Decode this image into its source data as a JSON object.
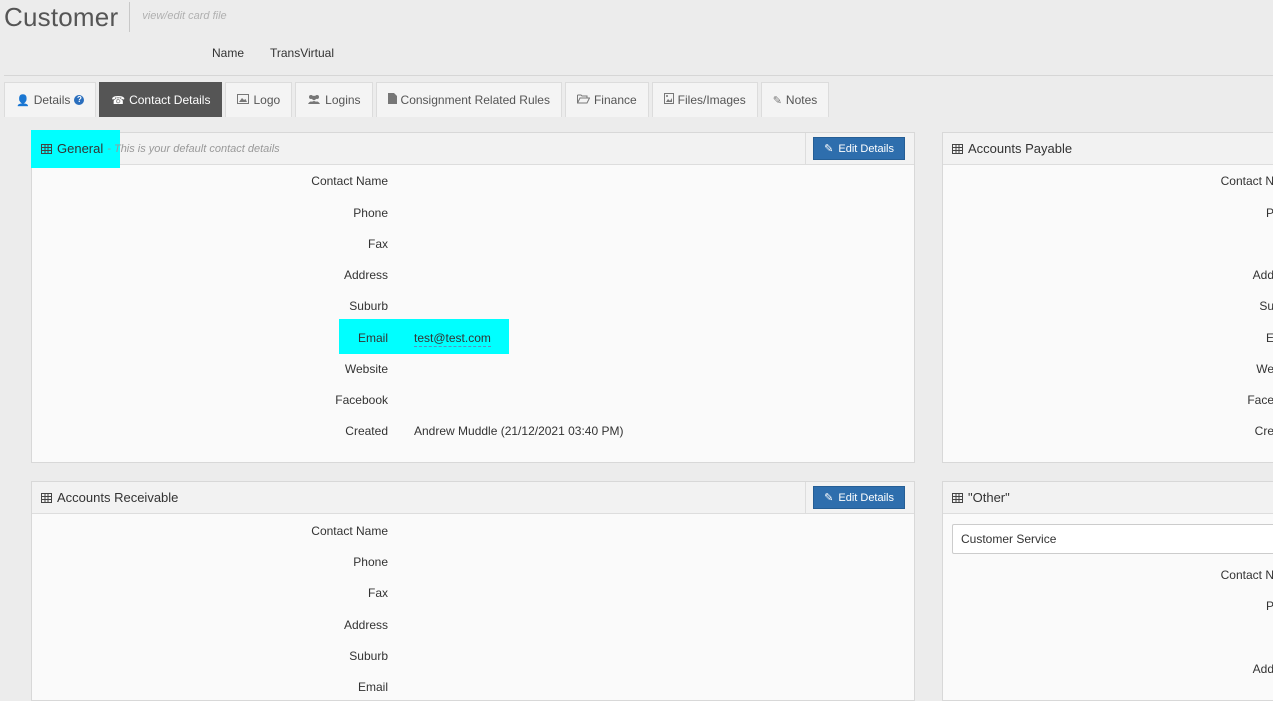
{
  "page": {
    "title": "Customer",
    "subtitle": "view/edit card file",
    "name_label": "Name",
    "name_value": "TransVirtual"
  },
  "tabs": [
    {
      "label": "Details",
      "icon": "user-icon",
      "help": "?"
    },
    {
      "label": "Contact Details",
      "icon": "phone-icon",
      "active": true
    },
    {
      "label": "Logo",
      "icon": "image-icon"
    },
    {
      "label": "Logins",
      "icon": "users-icon"
    },
    {
      "label": "Consignment Related Rules",
      "icon": "file-icon"
    },
    {
      "label": "Finance",
      "icon": "folder-open-icon"
    },
    {
      "label": "Files/Images",
      "icon": "file-image-icon"
    },
    {
      "label": "Notes",
      "icon": "pencil-icon"
    }
  ],
  "general": {
    "title": "General",
    "note": "- This is your default contact details",
    "edit_label": "Edit Details",
    "fields": [
      {
        "label": "Contact Name",
        "value": ""
      },
      {
        "label": "Phone",
        "value": ""
      },
      {
        "label": "Fax",
        "value": ""
      },
      {
        "label": "Address",
        "value": ""
      },
      {
        "label": "Suburb",
        "value": ""
      },
      {
        "label": "Email",
        "value": "test@test.com"
      },
      {
        "label": "Website",
        "value": ""
      },
      {
        "label": "Facebook",
        "value": ""
      },
      {
        "label": "Created",
        "value": "Andrew Muddle (21/12/2021 03:40 PM)"
      }
    ]
  },
  "accounts_payable": {
    "title": "Accounts Payable",
    "fields": [
      "Contact N",
      "P",
      "",
      "Add",
      "Su",
      "E",
      "We",
      "Face",
      "Cre"
    ]
  },
  "accounts_receivable": {
    "title": "Accounts Receivable",
    "edit_label": "Edit Details",
    "fields": [
      {
        "label": "Contact Name",
        "value": ""
      },
      {
        "label": "Phone",
        "value": ""
      },
      {
        "label": "Fax",
        "value": ""
      },
      {
        "label": "Address",
        "value": ""
      },
      {
        "label": "Suburb",
        "value": ""
      },
      {
        "label": "Email",
        "value": ""
      }
    ]
  },
  "other": {
    "title": "\"Other\"",
    "select_value": "Customer Service",
    "fields": [
      "Contact N",
      "P",
      "",
      "Add"
    ]
  },
  "colors": {
    "active_tab": "#555555",
    "edit_button": "#2e6ead",
    "highlight": "#00ffff"
  }
}
